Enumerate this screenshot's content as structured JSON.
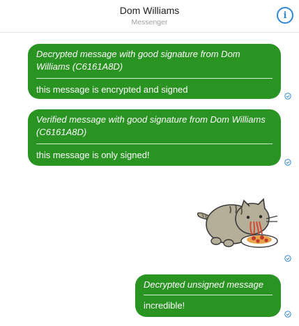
{
  "header": {
    "contact_name": "Dom Williams",
    "app_name": "Messenger",
    "info_label": "i"
  },
  "messages": [
    {
      "signature": "Decrypted message with good signature from Dom Williams (C6161A8D)",
      "text": "this message is encrypted and signed"
    },
    {
      "signature": "Verified message with good signature from Dom Williams (C6161A8D)",
      "text": "this message is only signed!"
    },
    {
      "sticker": "pusheen-cat-eating-spaghetti"
    },
    {
      "signature": "Decrypted unsigned message",
      "text": "incredible!"
    }
  ],
  "colors": {
    "bubble": "#2a9423",
    "accent": "#2d87d8",
    "check": "#2d87d8"
  }
}
